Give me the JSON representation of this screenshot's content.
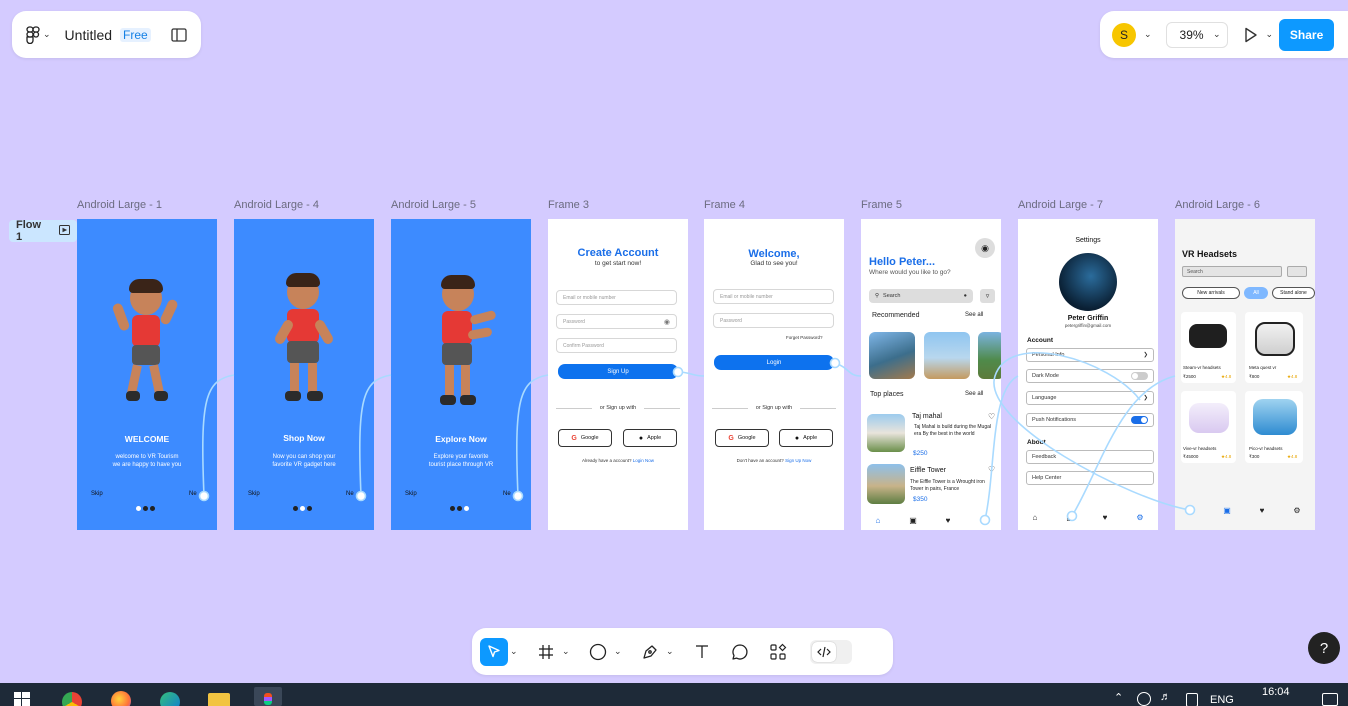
{
  "file": {
    "title": "Untitled",
    "plan_badge": "Free"
  },
  "header": {
    "avatar_initial": "S",
    "zoom": "39%",
    "share_label": "Share"
  },
  "flow": {
    "label": "Flow 1"
  },
  "frames": [
    {
      "title": "Android Large - 1"
    },
    {
      "title": "Android Large - 4"
    },
    {
      "title": "Android Large - 5"
    },
    {
      "title": "Frame 3"
    },
    {
      "title": "Frame 4"
    },
    {
      "title": "Frame 5"
    },
    {
      "title": "Android Large - 7"
    },
    {
      "title": "Android Large - 6"
    }
  ],
  "onboarding": [
    {
      "heading": "WELCOME",
      "line1": "welcome to VR Tourism",
      "line2": "we are happy to have you",
      "skip": "Skip",
      "next": "Ne"
    },
    {
      "heading": "Shop Now",
      "line1": "Now you can shop your",
      "line2": "favorite VR gadget here",
      "skip": "Skip",
      "next": "Ne"
    },
    {
      "heading": "Explore Now",
      "line1": "Explore your favorite",
      "line2": "tourist place through VR",
      "skip": "Skip",
      "next": "Ne"
    }
  ],
  "signup": {
    "title": "Create Account",
    "subtitle": "to get start now!",
    "email_placeholder": "Email or mobile number",
    "password_placeholder": "Password",
    "confirm_placeholder": "Confirm Password",
    "button": "Sign Up",
    "divider": "or Sign up with",
    "google": "Google",
    "apple": "Apple",
    "footer": "Already have a account?",
    "footer_link": "Login Now"
  },
  "login": {
    "title": "Welcome,",
    "subtitle": "Glad to see you!",
    "email_placeholder": "Email or mobile number",
    "password_placeholder": "Password",
    "forgot": "Forget Password?",
    "button": "Login",
    "divider": "or Sign up with",
    "google": "Google",
    "apple": "Apple",
    "footer": "Don't have an account?",
    "footer_link": "Sign Up Now"
  },
  "home": {
    "greeting": "Hello Peter...",
    "question": "Where would you like to go?",
    "search_placeholder": "Search",
    "recommended": "Recommended",
    "see_all": "See all",
    "top_places": "Top places",
    "see_all_2": "See all",
    "places": [
      {
        "name": "Taj mahal",
        "desc": "Taj Mahal is build during the Mugal era By the best in the world",
        "price": "$250"
      },
      {
        "name": "Eiffle Tower",
        "desc": "The Eiffle Tower is a Wrought iron Tower in pairs, France",
        "price": "$350"
      }
    ]
  },
  "settings": {
    "title": "Settings",
    "name": "Peter Griffin",
    "email": "petergriffin@gmail.com",
    "account_heading": "Account",
    "rows": [
      "Personal Info",
      "Dark Mode",
      "Language",
      "Push Notifications"
    ],
    "about_heading": "About",
    "about_rows": [
      "Feedback",
      "Help Center"
    ]
  },
  "shop": {
    "title": "VR Headsets",
    "search_placeholder": "Search",
    "filters": [
      "New arrivals",
      "All",
      "Stand alone"
    ],
    "products": [
      {
        "name": "Steam-vr headsets",
        "price": "₹2500",
        "rating": "4.8"
      },
      {
        "name": "Meta quest vr",
        "price": "₹800",
        "rating": "4.8"
      },
      {
        "name": "Vive-vr headsets",
        "price": "₹45000",
        "rating": "4.8"
      },
      {
        "name": "Pico-vr headsets",
        "price": "₹300",
        "rating": "4.8"
      }
    ]
  },
  "taskbar": {
    "time": "16:04",
    "language": "ENG"
  },
  "help": {
    "label": "?"
  }
}
